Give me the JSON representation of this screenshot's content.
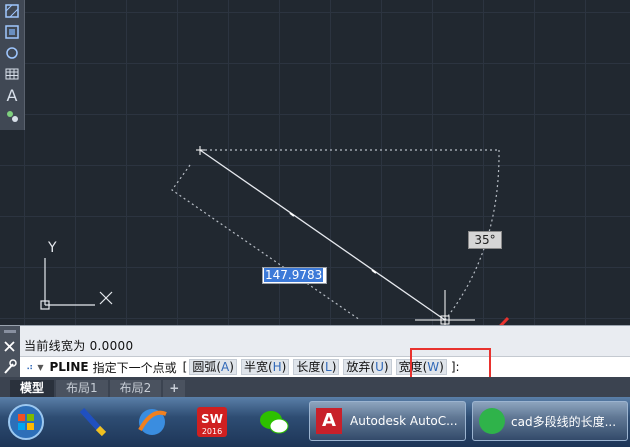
{
  "canvas": {
    "y_axis_label": "Y",
    "length_value": "147.9783",
    "angle_value": "35°"
  },
  "toolbar": {
    "icons": [
      "hatch-icon",
      "region-icon",
      "wipeout-icon",
      "table-icon",
      "text-icon",
      "add-point-icon"
    ],
    "text_glyph": "A"
  },
  "command": {
    "history_line": "当前线宽为 0.0000",
    "command_name": "PLINE",
    "prompt": "指定下一个点或",
    "open_bracket": "[",
    "options": [
      {
        "label": "圆弧(",
        "key": "A",
        "close": ")"
      },
      {
        "label": "半宽(",
        "key": "H",
        "close": ")"
      },
      {
        "label": "长度(",
        "key": "L",
        "close": ")"
      },
      {
        "label": "放弃(",
        "key": "U",
        "close": ")"
      },
      {
        "label": "宽度(",
        "key": "W",
        "close": ")"
      }
    ],
    "close_bracket": "]:"
  },
  "tabs": [
    "模型",
    "布局1",
    "布局2",
    "+"
  ],
  "taskbar": {
    "apps": [
      "start-orb",
      "paint-brush-app",
      "browser-app",
      "solidworks-2016",
      "wechat-app"
    ],
    "sw_label": "SW",
    "sw_year": "2016",
    "autocad_window": "Autodesk AutoC...",
    "browser_window": "cad多段线的长度..."
  },
  "colors": {
    "accent_highlight": "#e8322e",
    "selection": "#3d7ad8",
    "canvas_bg": "#212830"
  }
}
